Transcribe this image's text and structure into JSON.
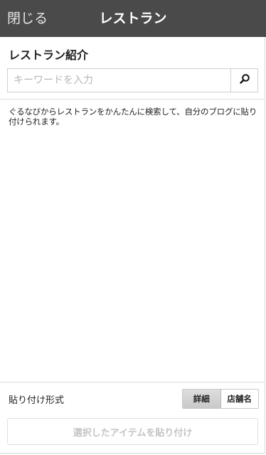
{
  "header": {
    "close_label": "閉じる",
    "title": "レストラン"
  },
  "section": {
    "title": "レストラン紹介"
  },
  "search": {
    "placeholder": "キーワードを入力",
    "value": "",
    "icon": "search-icon"
  },
  "description": "ぐるなびからレストランをかんたんに検索して、自分のブログに貼り付けられます。",
  "paste_format": {
    "label": "貼り付け形式",
    "options": [
      "詳細",
      "店舗名"
    ],
    "selected": "詳細"
  },
  "paste_button": {
    "label": "選択したアイテムを貼り付け",
    "enabled": false
  },
  "colors": {
    "header_bg": "#4a4a4a",
    "disabled_text": "#c4c4c4"
  }
}
